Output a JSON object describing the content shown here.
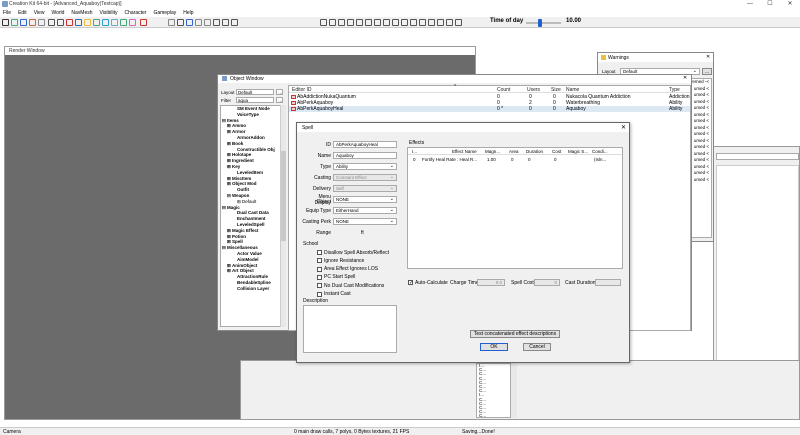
{
  "window": {
    "title": "Creation Kit 64-bit - [Advanced_Aquaboy(Testcap)]",
    "minimize": "—",
    "maximize": "☐",
    "close": "✕"
  },
  "menu": [
    "File",
    "Edit",
    "View",
    "World",
    "NavMesh",
    "Visibility",
    "Character",
    "Gameplay",
    "Help"
  ],
  "toolbar": {
    "time_of_day_label": "Time of day",
    "time_of_day_value": "10.00",
    "time_of_day_fraction": 0.4
  },
  "render_window": {
    "title": "Render Window"
  },
  "object_window": {
    "title": "Object Window",
    "layout_label": "Layout",
    "layout_value": "Default",
    "filter_label": "Filter",
    "filter_value": "aqua",
    "tree": [
      {
        "label": "SM Event Node",
        "indent": 2
      },
      {
        "label": "VoiceType",
        "indent": 2
      },
      {
        "label": "Items",
        "indent": 0,
        "expander": "⊟"
      },
      {
        "label": "Ammo",
        "indent": 1,
        "expander": "⊞"
      },
      {
        "label": "Armor",
        "indent": 1,
        "expander": "⊞"
      },
      {
        "label": "ArmorAddon",
        "indent": 2
      },
      {
        "label": "Book",
        "indent": 1,
        "expander": "⊞"
      },
      {
        "label": "Constructible Obj",
        "indent": 2
      },
      {
        "label": "Holotape",
        "indent": 1,
        "expander": "⊞"
      },
      {
        "label": "Ingredient",
        "indent": 1,
        "expander": "⊞"
      },
      {
        "label": "Key",
        "indent": 1,
        "expander": "⊞"
      },
      {
        "label": "LeveledItem",
        "indent": 2
      },
      {
        "label": "MiscItem",
        "indent": 1,
        "expander": "⊞"
      },
      {
        "label": "Object Mod",
        "indent": 1,
        "expander": "⊞"
      },
      {
        "label": "Outfit",
        "indent": 2
      },
      {
        "label": "Weapon",
        "indent": 1,
        "expander": "⊟"
      },
      {
        "label": "Default",
        "indent": 3,
        "expander": "⊞",
        "normal": true
      },
      {
        "label": "Magic",
        "indent": 0,
        "expander": "⊟"
      },
      {
        "label": "Dual Cast Data",
        "indent": 2
      },
      {
        "label": "Enchantment",
        "indent": 2
      },
      {
        "label": "LeveledSpell",
        "indent": 2
      },
      {
        "label": "Magic Effect",
        "indent": 1,
        "expander": "⊞"
      },
      {
        "label": "Potion",
        "indent": 1,
        "expander": "⊞"
      },
      {
        "label": "Spell",
        "indent": 1,
        "expander": "⊞"
      },
      {
        "label": "Miscellaneous",
        "indent": 0,
        "expander": "⊟"
      },
      {
        "label": "Actor Value",
        "indent": 2
      },
      {
        "label": "AimModel",
        "indent": 2
      },
      {
        "label": "AnimObject",
        "indent": 1,
        "expander": "⊞"
      },
      {
        "label": "Art Object",
        "indent": 1,
        "expander": "⊞"
      },
      {
        "label": "AttractionRule",
        "indent": 2
      },
      {
        "label": "BendableSpline",
        "indent": 2
      },
      {
        "label": "Collision Layer",
        "indent": 2
      }
    ],
    "columns": [
      "Editor ID",
      "Count",
      "Users",
      "Size",
      "Name",
      "Type"
    ],
    "rows": [
      {
        "id": "AbAddictionNukaQuantum",
        "count": "0",
        "users": "0",
        "size": "0",
        "name": "Nukacola Quantum Addiction",
        "type": "Addiction"
      },
      {
        "id": "AbPerkAquaboy",
        "count": "0",
        "users": "2",
        "size": "0",
        "name": "Waterbreathing",
        "type": "Ability"
      },
      {
        "id": "AbPerkAquaboyHeal",
        "count": "0 *",
        "users": "0",
        "size": "0",
        "name": "Aquaboy",
        "type": "Ability"
      }
    ]
  },
  "warnings": {
    "title": "Warnings",
    "layout_label": "Layout",
    "layout_value": "Default",
    "more": "...",
    "lines": [
      "ivemed -<",
      "umed <",
      "umed <",
      "umed <",
      "umed <",
      "umed <",
      "umed <",
      "umed <",
      "umed <",
      "umed <",
      "umed <",
      "umed <",
      "umed <",
      "umed <",
      "umed <",
      "umed <"
    ]
  },
  "spell": {
    "title": "Spell",
    "id_label": "ID",
    "id_value": "AbPerkAquaboyHeal",
    "name_label": "Name",
    "name_value": "Aquaboy",
    "type_label": "Type",
    "type_value": "Ability",
    "casting_label": "Casting",
    "casting_value": "Constant Effect",
    "delivery_label": "Delivery",
    "delivery_value": "Self",
    "menu_display_label1": "Menu Display",
    "menu_display_label2": "Object",
    "menu_display_value": "NONE",
    "equip_type_label": "Equip Type",
    "equip_type_value": "EitherHand",
    "casting_perk_label": "Casting Perk",
    "casting_perk_value": "NONE",
    "range_label": "Range",
    "range_unit": "ft",
    "school_label": "School",
    "flags": [
      {
        "label": "Disallow Spell Absorb/Reflect",
        "checked": false
      },
      {
        "label": "Ignore Resistance",
        "checked": false
      },
      {
        "label": "Area Effect Ignores LOS",
        "checked": false
      },
      {
        "label": "PC Start Spell",
        "checked": false
      },
      {
        "label": "No Dual Cast Modifications",
        "checked": false
      },
      {
        "label": "Instant Cast",
        "checked": false
      }
    ],
    "description_label": "Description",
    "effects_label": "Effects",
    "effects_columns": [
      "I...",
      "Effect Name",
      "Magn...",
      "Area",
      "Duration",
      "Cost",
      "Magic S...",
      "Condi..."
    ],
    "effects_rows": [
      {
        "i": "0",
        "name": "Fortify Heal Rate : Heal R...",
        "magnitude": "1.00",
        "area": "0",
        "duration": "0",
        "cost": "0",
        "magic_skill": "",
        "conditions": "(Isln..."
      }
    ],
    "auto_calc_label": "Auto-Calculate",
    "auto_calc_checked": true,
    "charge_time_label": "Charge Time",
    "charge_time_value": "0.0",
    "spell_cost_label": "Spell Cost",
    "spell_cost_value": "0",
    "cast_duration_label": "Cast Duration",
    "test_button": "Test concatenated effect descriptions",
    "ok_button": "OK",
    "cancel_button": "Cancel",
    "close": "✕"
  },
  "lower_panel": {
    "lines": [
      "I...",
      "C...",
      "C...",
      "C...",
      "C...",
      "C...",
      "C...",
      "I...",
      "C...",
      "C...",
      "C...",
      "C...",
      "C..."
    ]
  },
  "status": {
    "left": "Camera",
    "middle": "0 main draw calls, 7 polys, 0 Bytes textures, 21 FPS",
    "right": "Saving...Done!"
  }
}
